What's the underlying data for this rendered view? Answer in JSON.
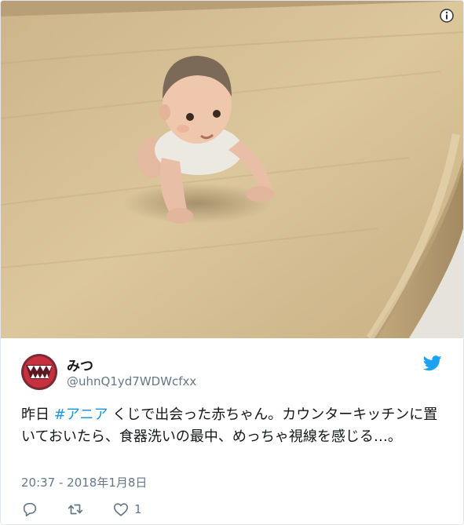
{
  "tweet": {
    "display_name": "みつ",
    "screen_name": "@uhnQ1yd7WDWcfxx",
    "text_before": "昨日 ",
    "hashtag": "#アニア",
    "text_after": " くじで出会った赤ちゃん。カウンターキッチンに置いておいたら、食器洗いの最中、めっちゃ視線を感じる…。",
    "timestamp": "20:37 - 2018年1月8日",
    "like_count": "1"
  },
  "icons": {
    "info": "info-icon",
    "bird": "twitter-bird-icon",
    "reply": "reply-icon",
    "retweet": "retweet-icon",
    "like": "heart-icon"
  },
  "colors": {
    "link": "#1b95e0",
    "secondary_text": "#657786",
    "primary_text": "#14171a",
    "border": "#e1e8ed"
  }
}
